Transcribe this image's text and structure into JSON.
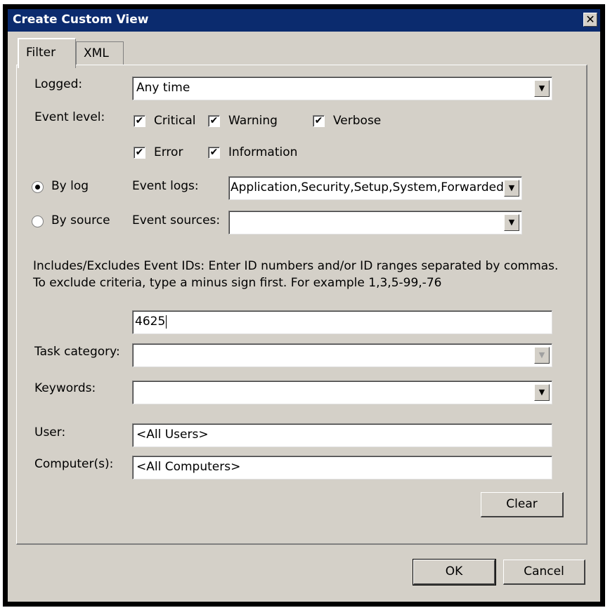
{
  "window": {
    "title": "Create Custom View",
    "close_glyph": "✕"
  },
  "tabs": [
    {
      "label": "Filter",
      "active": true
    },
    {
      "label": "XML",
      "active": false
    }
  ],
  "filter": {
    "logged": {
      "label": "Logged:",
      "value": "Any time"
    },
    "event_level": {
      "label": "Event level:",
      "options": [
        {
          "label": "Critical",
          "checked": true
        },
        {
          "label": "Warning",
          "checked": true
        },
        {
          "label": "Verbose",
          "checked": true
        },
        {
          "label": "Error",
          "checked": true
        },
        {
          "label": "Information",
          "checked": true
        }
      ]
    },
    "by_log": {
      "label": "By log",
      "selected": true
    },
    "by_source": {
      "label": "By source",
      "selected": false
    },
    "event_logs": {
      "label": "Event logs:",
      "value": "Application,Security,Setup,System,Forwarded E"
    },
    "event_sources": {
      "label": "Event sources:",
      "value": ""
    },
    "event_ids": {
      "description": "Includes/Excludes Event IDs: Enter ID numbers and/or ID ranges separated by commas. To exclude criteria, type a minus sign first. For example 1,3,5-99,-76",
      "value": "4625"
    },
    "task_category": {
      "label": "Task category:",
      "value": ""
    },
    "keywords": {
      "label": "Keywords:",
      "value": ""
    },
    "user": {
      "label": "User:",
      "value": "<All Users>"
    },
    "computers": {
      "label": "Computer(s):",
      "value": "<All Computers>"
    },
    "clear_label": "Clear"
  },
  "footer": {
    "ok_label": "OK",
    "cancel_label": "Cancel"
  },
  "icons": {
    "check": "✔",
    "dropdown": "▼"
  }
}
